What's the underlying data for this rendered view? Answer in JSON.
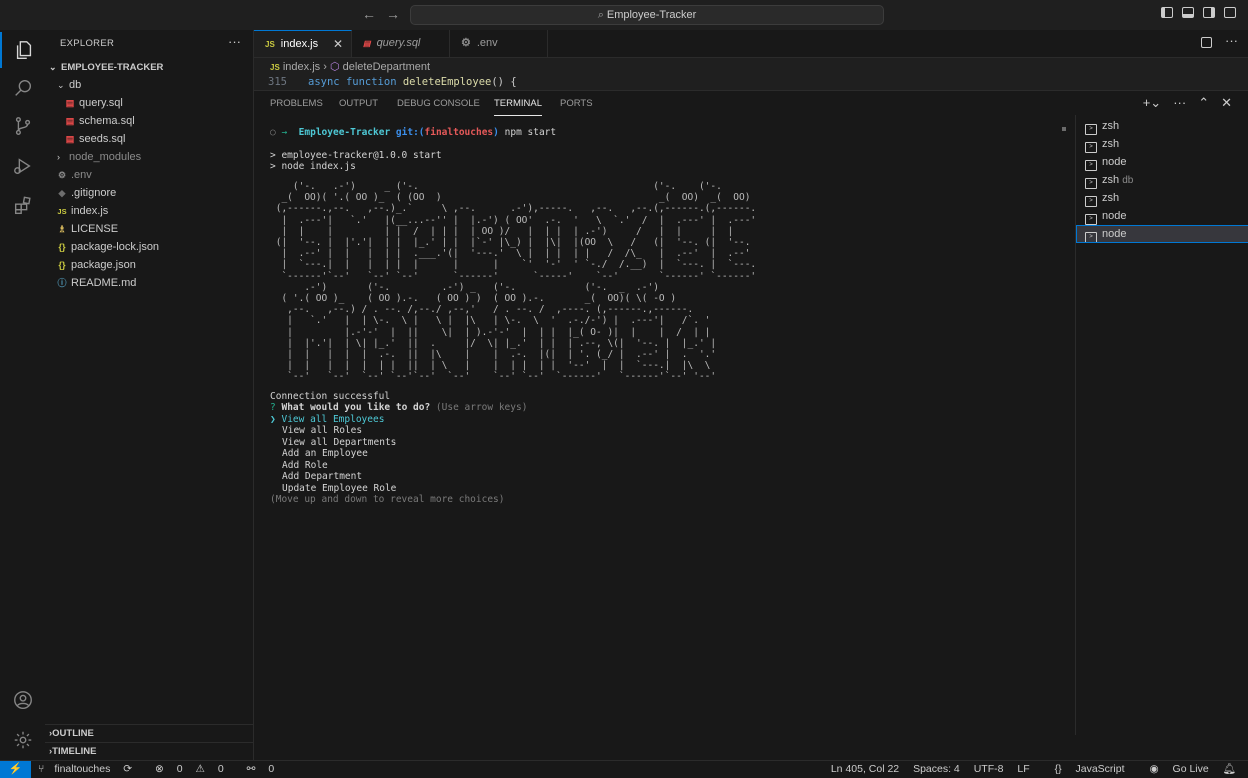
{
  "titlebar": {
    "search_text": "Employee-Tracker",
    "back_icon": "arrow-left-icon",
    "forward_icon": "arrow-right-icon"
  },
  "explorer": {
    "header": "EXPLORER",
    "more": "···",
    "root": "EMPLOYEE-TRACKER",
    "items": [
      {
        "label": "db",
        "kind": "folder-open",
        "indent": 1
      },
      {
        "label": "query.sql",
        "kind": "sql",
        "indent": 2
      },
      {
        "label": "schema.sql",
        "kind": "sql",
        "indent": 2
      },
      {
        "label": "seeds.sql",
        "kind": "sql",
        "indent": 2
      },
      {
        "label": "node_modules",
        "kind": "folder-closed",
        "indent": 1
      },
      {
        "label": ".env",
        "kind": "env",
        "indent": 1
      },
      {
        "label": ".gitignore",
        "kind": "git",
        "indent": 1
      },
      {
        "label": "index.js",
        "kind": "js",
        "indent": 1
      },
      {
        "label": "LICENSE",
        "kind": "license",
        "indent": 1
      },
      {
        "label": "package-lock.json",
        "kind": "json",
        "indent": 1
      },
      {
        "label": "package.json",
        "kind": "json",
        "indent": 1
      },
      {
        "label": "README.md",
        "kind": "md",
        "indent": 1
      }
    ],
    "outline": "OUTLINE",
    "timeline": "TIMELINE"
  },
  "tabs": [
    {
      "label": "index.js",
      "icon": "JS",
      "active": true,
      "close": "✕"
    },
    {
      "label": "query.sql",
      "icon": "sql-icon",
      "active": false
    },
    {
      "label": ".env",
      "icon": "gear-icon",
      "active": false
    }
  ],
  "breadcrumb": {
    "file": "index.js",
    "symbol": "deleteDepartment"
  },
  "code": {
    "line_number": "315",
    "keyword1": "async",
    "keyword2": "function",
    "fn": "deleteEmployee",
    "rest": "() {"
  },
  "panel": {
    "tabs": [
      "PROBLEMS",
      "OUTPUT",
      "DEBUG CONSOLE",
      "TERMINAL",
      "PORTS"
    ],
    "active_tab": "TERMINAL"
  },
  "terminal": {
    "prompt_dir": "Employee-Tracker",
    "git_label": "git:(",
    "branch": "finaltouches",
    "git_close": ")",
    "command": "npm start",
    "script_line1": "> employee-tracker@1.0.0 start",
    "script_line2": "> node index.js",
    "ascii_art": "    ('-.   .-')     _ ('-.                                         ('-.    ('-.\n  _(  OO)( '.( OO )_  ( (OO  )                                      _(  OO)  _(  OO)\n (,------.,--.   ,--.)_.`     \\ ,--.      .-'),-----.   ,--.   ,--.(,------.(,------.\n  |  .---'|   `.'   |(__...--'' |  |.-') ( OO'  .-.  '   \\  `.'  /  |  .---' |  .---'\n  |  |    |         | |  /  | | |  | OO )/   |  | |  | .-')     /   |  |     |  |\n (|  '--. |  |'.'|  | |  |_.' | |  |`-' |\\_) |  |\\|  |(OO  \\   /   (|  '--. (|  '--.\n  |  .--' |  |   |  | |  .___.'(|  '---.'  \\ |  | |  | |   /  /\\_   |  .--'  |  .--'\n  |  `---.|  |   |  | |  |      |      |    `'  '-'  ' `-./  /.__)  |  `---. |  `---.\n  `------'`--'   `--' `--'      `------'      `-----'    `--'       `------' `------'\n      .-')       ('-.         .-') _   ('-.            ('-.  _  .-')\n  ( '.( OO )_    ( OO ).-.   ( OO ) )  ( OO ).-.       _(  OO)( \\( -O )\n   ,--.   ,--.) / . --. /,--./ ,--,'   / . --. /  ,----. (,------.,------.\n   |   `.'   |  | \\-.  \\ |   \\ |  |\\   | \\-.  \\  '  .-./-') |  .---'|   /`. '\n   |         |.-'-'  |  ||    \\|  | ).-'-'  |  | |  |_( O- )|  |    |  /  | |\n   |  |'.'|  | \\| |_.'  ||  .     |/  \\| |_.'  | |  | .--, \\(|  '--. |  |_.' |\n   |  |   |  |  |  .-.  ||  |\\    |    |  .-.  |(|  | '. (_/ |  .--' |  .  '.'\n   |  |   |  |  |  | |  ||  | \\   |    |  | |  | |  '--'  |  |  `---.|  |\\  \\\n   `--'   `--'  `--' `--'`--'  `--'    `--' `--'  `------'   `------'`--' '--'",
    "connection": "Connection successful",
    "question_mark": "?",
    "question": "What would you like to do?",
    "hint": "(Use arrow keys)",
    "pointer": "❯",
    "choices": [
      "View all Employees",
      "View all Roles",
      "View all Departments",
      "Add an Employee",
      "Add Role",
      "Add Department",
      "Update Employee Role"
    ],
    "more_hint": "(Move up and down to reveal more choices)"
  },
  "terminal_list": [
    {
      "label": "zsh",
      "sub": ""
    },
    {
      "label": "zsh",
      "sub": ""
    },
    {
      "label": "node",
      "sub": ""
    },
    {
      "label": "zsh",
      "sub": "db"
    },
    {
      "label": "zsh",
      "sub": ""
    },
    {
      "label": "node",
      "sub": ""
    },
    {
      "label": "node",
      "sub": "",
      "selected": true
    }
  ],
  "statusbar": {
    "branch": "finaltouches",
    "errors": "0",
    "warnings": "0",
    "ports": "0",
    "position": "Ln 405, Col 22",
    "spaces": "Spaces: 4",
    "encoding": "UTF-8",
    "eol": "LF",
    "language": "JavaScript",
    "golive": "Go Live"
  },
  "colors": {
    "accent": "#0078d4",
    "background": "#181818",
    "prompt_cyan": "#4ec9d6"
  }
}
